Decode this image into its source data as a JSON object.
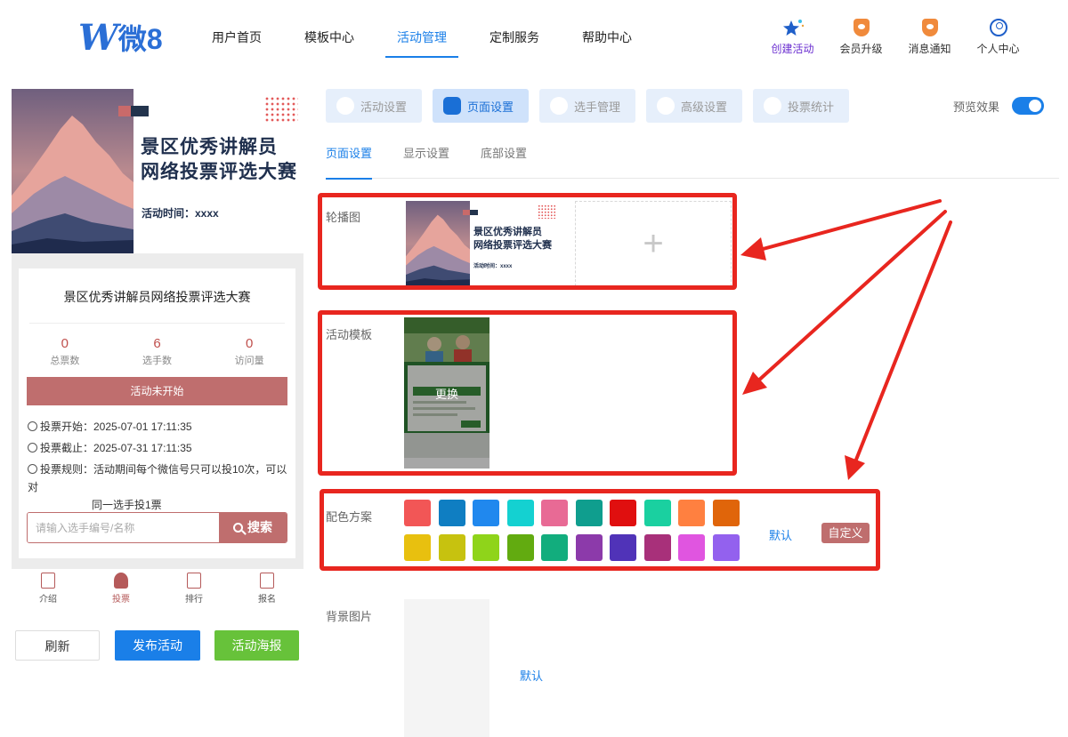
{
  "header": {
    "logo_w": "W",
    "logo_text": "微8",
    "nav": [
      "用户首页",
      "模板中心",
      "活动管理",
      "定制服务",
      "帮助中心"
    ],
    "nav_active": 2,
    "tools": {
      "create": "创建活动",
      "upgrade": "会员升级",
      "notify": "消息通知",
      "profile": "个人中心"
    }
  },
  "preview": {
    "banner_title_line1": "景区优秀讲解员",
    "banner_title_line2": "网络投票评选大赛",
    "banner_time": "活动时间：xxxx",
    "card_title": "景区优秀讲解员网络投票评选大赛",
    "stats": [
      {
        "value": "0",
        "label": "总票数"
      },
      {
        "value": "6",
        "label": "选手数"
      },
      {
        "value": "0",
        "label": "访问量"
      }
    ],
    "status": "活动未开始",
    "vote_start": "投票开始：2025-07-01 17:11:35",
    "vote_end": "投票截止：2025-07-31 17:11:35",
    "vote_rule_line1": "投票规则：活动期间每个微信号只可以投10次，可以对",
    "vote_rule_line2": "同一选手投1票",
    "search_placeholder": "请输入选手编号/名称",
    "search_button": "搜索",
    "bottom_nav": [
      "介绍",
      "投票",
      "排行",
      "报名"
    ],
    "bottom_nav_active": 1
  },
  "actions": {
    "refresh": "刷新",
    "publish": "发布活动",
    "poster": "活动海报"
  },
  "settings": {
    "steps": [
      "活动设置",
      "页面设置",
      "选手管理",
      "高级设置",
      "投票统计"
    ],
    "step_active": 1,
    "preview_label": "预览效果",
    "preview_on": true,
    "subtabs": [
      "页面设置",
      "显示设置",
      "底部设置"
    ],
    "subtab_active": 0,
    "carousel_label": "轮播图",
    "carousel_thumb_title_line1": "景区优秀讲解员",
    "carousel_thumb_title_line2": "网络投票评选大赛",
    "carousel_thumb_time": "活动时间：xxxx",
    "add_symbol": "+",
    "template_label": "活动模板",
    "template_change": "更换",
    "color_label": "配色方案",
    "colors_row1": [
      "#f25656",
      "#0f7ec2",
      "#2088ee",
      "#14d1d1",
      "#e86a95",
      "#0f9e8e",
      "#e00f0f",
      "#1ad0a0",
      "#ff8040",
      "#e0650a"
    ],
    "colors_row2": [
      "#e8c00f",
      "#c7c20f",
      "#8fd41a",
      "#62ab10",
      "#12ad7d",
      "#8c3aaa",
      "#5033b8",
      "#a8307a",
      "#e055e0",
      "#9361ee"
    ],
    "color_default": "默认",
    "color_custom": "自定义",
    "bg_label": "背景图片",
    "bg_default": "默认"
  }
}
